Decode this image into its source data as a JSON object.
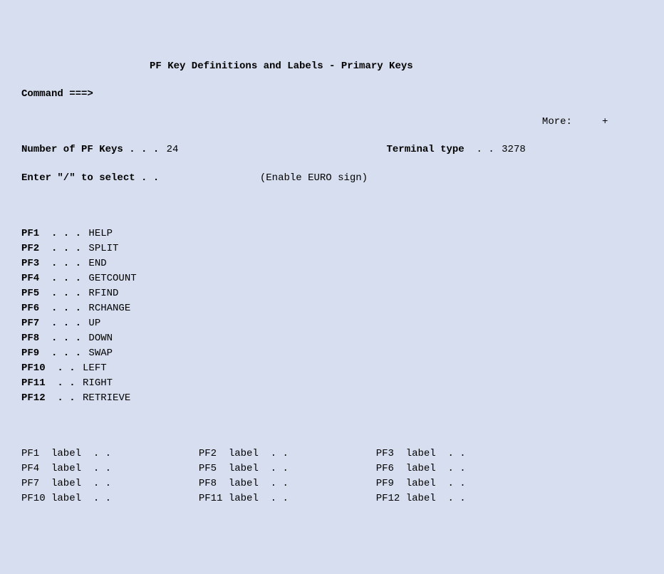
{
  "title": "PF Key Definitions and Labels - Primary Keys",
  "command_prompt": "Command ===>",
  "command_value": "",
  "more_label": "More:",
  "more_indicator": "+",
  "num_pf_label": "Number of PF Keys . . .",
  "num_pf_value": "24",
  "term_type_label": "Terminal type",
  "term_type_dots": ". .",
  "term_type_value": "3278",
  "select_label": "Enter \"/\" to select . .",
  "select_value": "",
  "euro_hint": "(Enable EURO sign)",
  "pf": [
    {
      "key": "PF1 ",
      "dots": ". . .",
      "val": "HELP"
    },
    {
      "key": "PF2 ",
      "dots": ". . .",
      "val": "SPLIT"
    },
    {
      "key": "PF3 ",
      "dots": ". . .",
      "val": "END"
    },
    {
      "key": "PF4 ",
      "dots": ". . .",
      "val": "GETCOUNT"
    },
    {
      "key": "PF5 ",
      "dots": ". . .",
      "val": "RFIND"
    },
    {
      "key": "PF6 ",
      "dots": ". . .",
      "val": "RCHANGE"
    },
    {
      "key": "PF7 ",
      "dots": ". . .",
      "val": "UP"
    },
    {
      "key": "PF8 ",
      "dots": ". . .",
      "val": "DOWN"
    },
    {
      "key": "PF9 ",
      "dots": ". . .",
      "val": "SWAP"
    },
    {
      "key": "PF10",
      "dots": " . .",
      "val": "LEFT"
    },
    {
      "key": "PF11",
      "dots": " . .",
      "val": "RIGHT"
    },
    {
      "key": "PF12",
      "dots": " . .",
      "val": "RETRIEVE"
    }
  ],
  "label_rows": [
    [
      {
        "k": "PF1 ",
        "v": ""
      },
      {
        "k": "PF2 ",
        "v": ""
      },
      {
        "k": "PF3 ",
        "v": ""
      }
    ],
    [
      {
        "k": "PF4 ",
        "v": ""
      },
      {
        "k": "PF5 ",
        "v": ""
      },
      {
        "k": "PF6 ",
        "v": ""
      }
    ],
    [
      {
        "k": "PF7 ",
        "v": ""
      },
      {
        "k": "PF8 ",
        "v": ""
      },
      {
        "k": "PF9 ",
        "v": ""
      }
    ],
    [
      {
        "k": "PF10",
        "v": ""
      },
      {
        "k": "PF11",
        "v": ""
      },
      {
        "k": "PF12",
        "v": ""
      }
    ]
  ],
  "label_word": "label",
  "label_dots": ". ."
}
